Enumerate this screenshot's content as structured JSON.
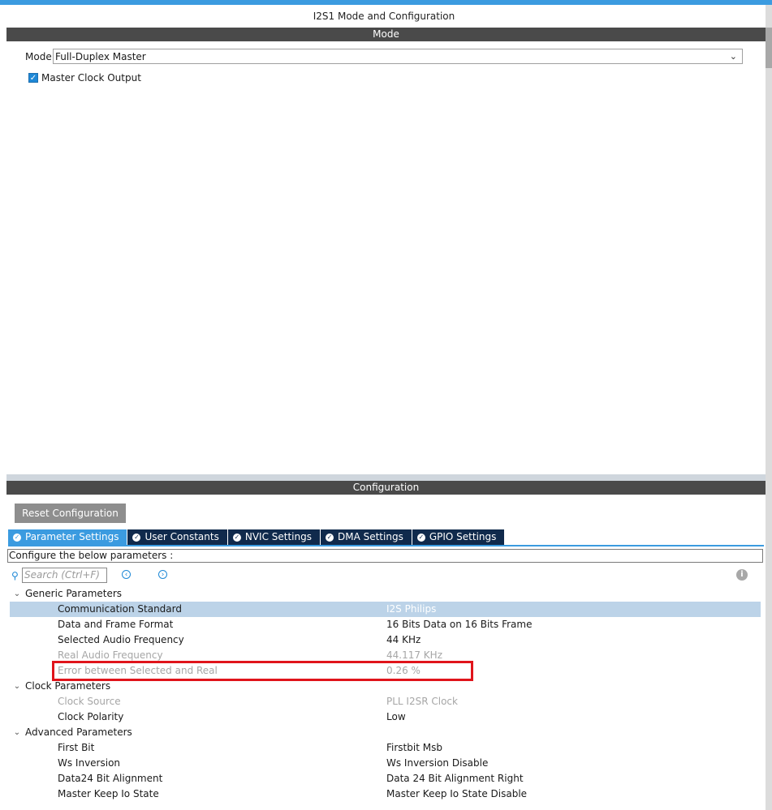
{
  "window": {
    "title": "I2S1 Mode and Configuration"
  },
  "colors": {
    "accent": "#3b9be0",
    "tab_dark": "#102a4c",
    "header": "#4a4a4a",
    "highlight": "#e0141b"
  },
  "mode_section": {
    "header": "Mode",
    "mode_label": "Mode",
    "mode_value": "Full-Duplex Master",
    "master_clock_label": "Master Clock Output",
    "master_clock_checked": true
  },
  "config_section": {
    "header": "Configuration",
    "reset_label": "Reset Configuration",
    "tabs": [
      {
        "label": "Parameter Settings",
        "active": true
      },
      {
        "label": "User Constants",
        "active": false
      },
      {
        "label": "NVIC Settings",
        "active": false
      },
      {
        "label": "DMA Settings",
        "active": false
      },
      {
        "label": "GPIO Settings",
        "active": false
      }
    ],
    "configure_text": "Configure the below parameters :",
    "search_placeholder": "Search (Ctrl+F)",
    "groups": [
      {
        "label": "Generic Parameters",
        "params": [
          {
            "name": "Communication Standard",
            "value": "I2S Philips",
            "selected": true,
            "disabled": false
          },
          {
            "name": "Data and Frame Format",
            "value": "16 Bits Data on 16 Bits Frame",
            "selected": false,
            "disabled": false
          },
          {
            "name": "Selected Audio Frequency",
            "value": "44 KHz",
            "selected": false,
            "disabled": false
          },
          {
            "name": "Real Audio Frequency",
            "value": "44.117 KHz",
            "selected": false,
            "disabled": true
          },
          {
            "name": "Error between Selected and Real",
            "value": "0.26 %",
            "selected": false,
            "disabled": true
          }
        ]
      },
      {
        "label": "Clock Parameters",
        "params": [
          {
            "name": "Clock Source",
            "value": "PLL I2SR Clock",
            "selected": false,
            "disabled": true
          },
          {
            "name": "Clock Polarity",
            "value": "Low",
            "selected": false,
            "disabled": false
          }
        ]
      },
      {
        "label": "Advanced Parameters",
        "params": [
          {
            "name": "First Bit",
            "value": "Firstbit Msb",
            "selected": false,
            "disabled": false
          },
          {
            "name": "Ws Inversion",
            "value": "Ws Inversion Disable",
            "selected": false,
            "disabled": false
          },
          {
            "name": "Data24 Bit Alignment",
            "value": "Data 24 Bit Alignment Right",
            "selected": false,
            "disabled": false
          },
          {
            "name": "Master Keep Io State",
            "value": "Master Keep Io State Disable",
            "selected": false,
            "disabled": false
          }
        ]
      }
    ]
  }
}
